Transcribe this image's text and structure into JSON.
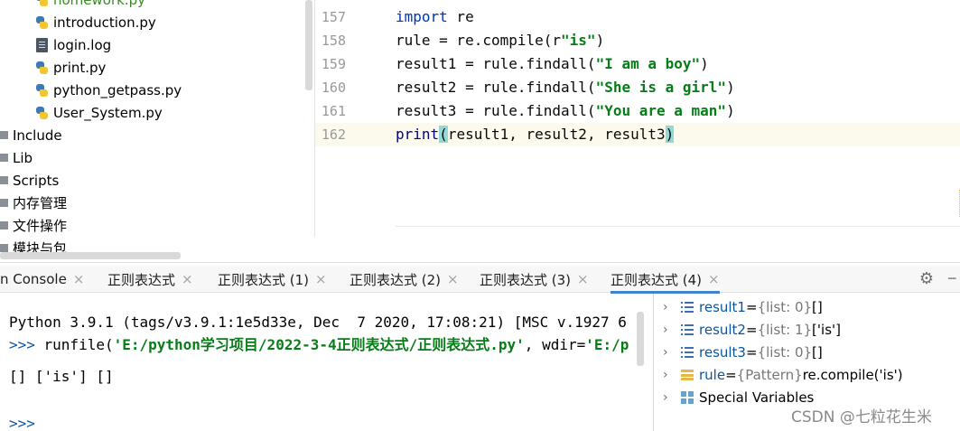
{
  "project_tree": {
    "items": [
      {
        "label": "homework.py",
        "icon": "python-file-icon",
        "color": "#3a8a24"
      },
      {
        "label": "introduction.py",
        "icon": "python-file-icon"
      },
      {
        "label": "login.log",
        "icon": "log-file-icon"
      },
      {
        "label": "print.py",
        "icon": "python-file-icon"
      },
      {
        "label": "python_getpass.py",
        "icon": "python-file-icon"
      },
      {
        "label": "User_System.py",
        "icon": "python-file-icon"
      },
      {
        "label": "Include",
        "icon": "folder-icon"
      },
      {
        "label": "Lib",
        "icon": "folder-icon"
      },
      {
        "label": "Scripts",
        "icon": "folder-icon"
      },
      {
        "label": "内存管理",
        "icon": "folder-icon"
      },
      {
        "label": "文件操作",
        "icon": "folder-icon"
      },
      {
        "label": "模块与包",
        "icon": "folder-icon"
      }
    ]
  },
  "editor": {
    "lines": [
      {
        "num": "157",
        "parts": [
          [
            "kw",
            "import"
          ],
          [
            "plain",
            " re"
          ]
        ]
      },
      {
        "num": "158",
        "parts": [
          [
            "plain",
            "rule = re.compile("
          ],
          [
            "plain",
            "r"
          ],
          [
            "str",
            "\"is\""
          ],
          [
            "plain",
            ")"
          ]
        ]
      },
      {
        "num": "159",
        "parts": [
          [
            "plain",
            "result1 = rule.findall("
          ],
          [
            "str",
            "\"I am a boy\""
          ],
          [
            "plain",
            ")"
          ]
        ]
      },
      {
        "num": "160",
        "parts": [
          [
            "plain",
            "result2 = rule.findall("
          ],
          [
            "str",
            "\"She is a girl\""
          ],
          [
            "plain",
            ")"
          ]
        ]
      },
      {
        "num": "161",
        "parts": [
          [
            "plain",
            "result3 = rule.findall("
          ],
          [
            "str",
            "\"You are a man\""
          ],
          [
            "plain",
            ")"
          ]
        ]
      },
      {
        "num": "162",
        "parts": [
          [
            "fn",
            "print"
          ],
          [
            "brace",
            "("
          ],
          [
            "plain",
            "result1, result2, result3"
          ],
          [
            "brace",
            ")"
          ]
        ],
        "current": true
      }
    ]
  },
  "tabs": [
    {
      "label": "n Console",
      "active": false
    },
    {
      "label": "正则表达式",
      "active": false
    },
    {
      "label": "正则表达式 (1)",
      "active": false
    },
    {
      "label": "正则表达式 (2)",
      "active": false
    },
    {
      "label": "正则表达式 (3)",
      "active": false
    },
    {
      "label": "正则表达式 (4)",
      "active": true
    }
  ],
  "tab_close_glyph": "×",
  "toolbar": {
    "settings_icon": "gear-icon",
    "settings_glyph": "⚙",
    "hide_icon": "minus-icon",
    "hide_glyph": "−"
  },
  "console": {
    "line1": "Python 3.9.1 (tags/v3.9.1:1e5d33e, Dec  7 2020, 17:08:21) [MSC v.1927 6",
    "line2_prompt": ">>> ",
    "line2_pre": "runfile(",
    "line2_str1": "'E:/python学习项目/2022-3-4正则表达式/正则表达式.py'",
    "line2_mid": ", wdir=",
    "line2_str2": "'E:/p",
    "line3": "[] ['is'] []",
    "line4_prompt": ">>>"
  },
  "variables": [
    {
      "name": "result1",
      "type": "{list: 0}",
      "value": "[]",
      "icon": "list-icon"
    },
    {
      "name": "result2",
      "type": "{list: 1}",
      "value": "['is']",
      "icon": "list-icon"
    },
    {
      "name": "result3",
      "type": "{list: 0}",
      "value": "[]",
      "icon": "list-icon"
    },
    {
      "name": "rule",
      "type": "{Pattern}",
      "value": "re.compile('is')",
      "icon": "pattern-icon"
    },
    {
      "name": "Special Variables",
      "type": "",
      "value": "",
      "icon": "special-variables-icon"
    }
  ],
  "var_separator": " = ",
  "chevron": "›",
  "watermark": "CSDN @七粒花生米"
}
